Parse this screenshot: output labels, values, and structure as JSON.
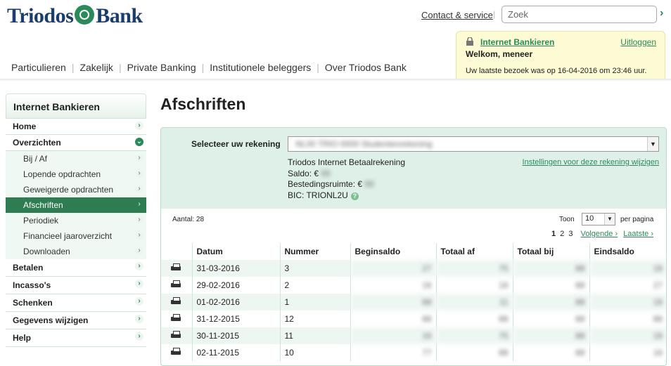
{
  "header": {
    "logo_text_left": "Triodos",
    "logo_text_right": "Bank",
    "contact_link": "Contact & service",
    "search_placeholder": "Zoek"
  },
  "topnav": [
    "Particulieren",
    "Zakelijk",
    "Private Banking",
    "Institutionele beleggers",
    "Over Triodos Bank"
  ],
  "welcome": {
    "title": "Internet Bankieren",
    "logout": "Uitloggen",
    "greeting": "Welkom, meneer",
    "last_visit": "Uw laatste bezoek was op 16-04-2016 om 23:46 uur."
  },
  "sidebar": {
    "title": "Internet Bankieren",
    "items": {
      "home": "Home",
      "overzichten": "Overzichten",
      "bij_af": "Bij / Af",
      "lopende": "Lopende opdrachten",
      "geweigerde": "Geweigerde opdrachten",
      "afschriften": "Afschriften",
      "periodiek": "Periodiek",
      "financieel": "Financieel jaaroverzicht",
      "downloaden": "Downloaden",
      "betalen": "Betalen",
      "incasso": "Incasso's",
      "schenken": "Schenken",
      "gegevens": "Gegevens wijzigen",
      "help": "Help"
    }
  },
  "main": {
    "title": "Afschriften",
    "select_label": "Selecteer uw rekening",
    "account_value": "NL00 TRIO 0000 Studentenrekening",
    "account_type": "Triodos Internet Betaalrekening",
    "saldo_label": "Saldo: €",
    "saldo_value": "00",
    "bestedings_label": "Bestedingsruimte: €",
    "bestedings_value": "00",
    "bic": "BIC: TRIONL2U",
    "settings_link": "Instellingen voor deze rekening wijzigen",
    "aantal": "Aantal: 28",
    "toon": "Toon",
    "per_page_value": "10",
    "per_page_label": "per pagina",
    "pages": [
      "1",
      "2",
      "3"
    ],
    "volgende": "Volgende ›",
    "laatste": "Laatste ›"
  },
  "table": {
    "headers": [
      "Datum",
      "Nummer",
      "Beginsaldo",
      "Totaal af",
      "Totaal bij",
      "Eindsaldo"
    ],
    "rows": [
      {
        "datum": "31-03-2016",
        "nummer": "3",
        "begin": "27",
        "af": "75",
        "bij": "88",
        "eind": "16"
      },
      {
        "datum": "29-02-2016",
        "nummer": "2",
        "begin": "16",
        "af": "16",
        "bij": "88",
        "eind": "27"
      },
      {
        "datum": "01-02-2016",
        "nummer": "1",
        "begin": "88",
        "af": "11",
        "bij": "88",
        "eind": "16"
      },
      {
        "datum": "31-12-2015",
        "nummer": "12",
        "begin": "88",
        "af": "88",
        "bij": "88",
        "eind": "88"
      },
      {
        "datum": "30-11-2015",
        "nummer": "11",
        "begin": "16",
        "af": "75",
        "bij": "88",
        "eind": "16"
      },
      {
        "datum": "02-11-2015",
        "nummer": "10",
        "begin": "77",
        "af": "88",
        "bij": "88",
        "eind": "16"
      }
    ]
  }
}
